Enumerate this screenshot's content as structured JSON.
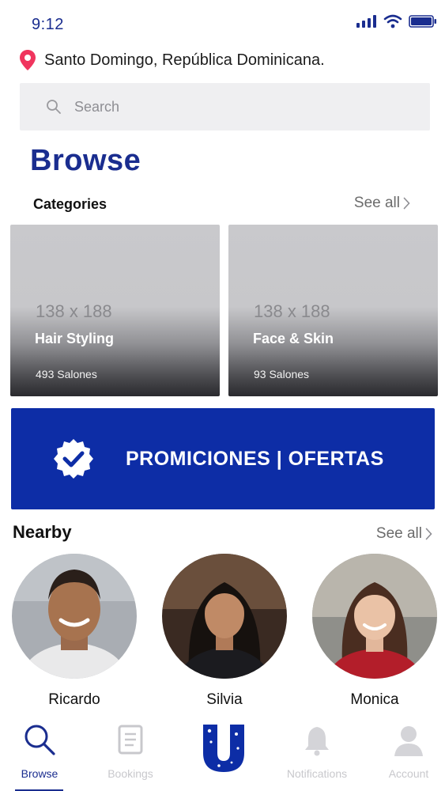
{
  "status": {
    "time": "9:12"
  },
  "location": {
    "text": "Santo Domingo, República Dominicana."
  },
  "search": {
    "placeholder": "Search"
  },
  "page": {
    "title": "Browse"
  },
  "categories": {
    "title": "Categories",
    "see_all": "See all",
    "items": [
      {
        "placeholder": "138 x 188",
        "name": "Hair Styling",
        "count": "493 Salones"
      },
      {
        "placeholder": "138 x 188",
        "name": "Face & Skin",
        "count": "93 Salones"
      }
    ]
  },
  "promo": {
    "label": "PROMICIONES | OFERTAS",
    "color": "#0d2da6"
  },
  "nearby": {
    "title": "Nearby",
    "see_all": "See all",
    "people": [
      {
        "name": "Ricardo"
      },
      {
        "name": "Silvia"
      },
      {
        "name": "Monica"
      }
    ]
  },
  "tabs": [
    {
      "label": "Browse",
      "icon": "search-icon",
      "active": true
    },
    {
      "label": "Bookings",
      "icon": "document-icon",
      "active": false
    },
    {
      "label": "",
      "icon": "app-logo-icon",
      "active": false
    },
    {
      "label": "Notifications",
      "icon": "bell-icon",
      "active": false
    },
    {
      "label": "Account",
      "icon": "person-icon",
      "active": false
    }
  ],
  "colors": {
    "brand": "#1a2d8f",
    "pin": "#f0355e"
  }
}
